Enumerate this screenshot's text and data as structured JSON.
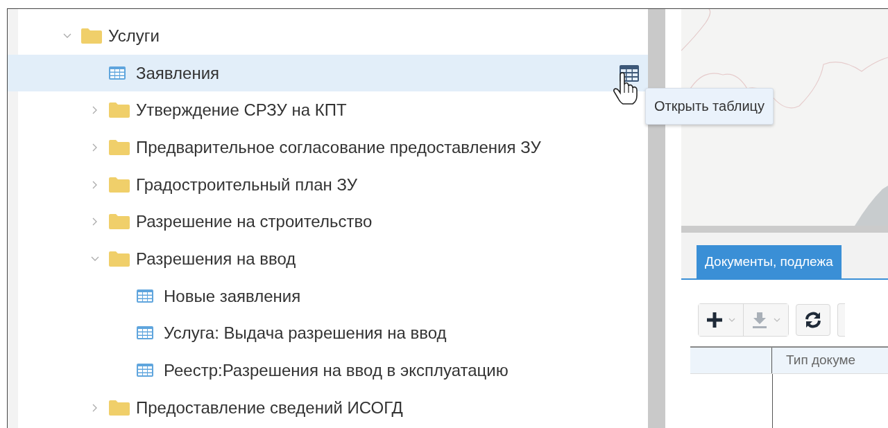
{
  "tree": [
    {
      "label": "Услуги",
      "kind": "folder",
      "expanded": true,
      "selected": false,
      "children": [
        {
          "label": "Заявления",
          "kind": "table",
          "selected": true,
          "hover_action": true
        },
        {
          "label": "Утверждение СРЗУ на КПТ",
          "kind": "folder",
          "expanded": false,
          "selected": false
        },
        {
          "label": "Предварительное согласование предоставления ЗУ",
          "kind": "folder",
          "expanded": false,
          "selected": false
        },
        {
          "label": "Градостроительный план ЗУ",
          "kind": "folder",
          "expanded": false,
          "selected": false
        },
        {
          "label": "Разрешение на строительство",
          "kind": "folder",
          "expanded": false,
          "selected": false
        },
        {
          "label": "Разрешения на ввод",
          "kind": "folder",
          "expanded": true,
          "selected": false,
          "children": [
            {
              "label": "Новые заявления",
              "kind": "table",
              "selected": false
            },
            {
              "label": "Услуга: Выдача разрешения на ввод",
              "kind": "table",
              "selected": false
            },
            {
              "label": "Реестр:Разрешения на ввод в эксплуатацию",
              "kind": "table",
              "selected": false
            }
          ]
        },
        {
          "label": "Предоставление сведений ИСОГД",
          "kind": "folder",
          "expanded": false,
          "selected": false
        }
      ]
    }
  ],
  "tooltip": "Открыть таблицу",
  "tabs": [
    {
      "label": "Документы, подлежа",
      "selected": true
    }
  ],
  "toolbar": [
    {
      "kind": "add",
      "disabled": false
    },
    {
      "kind": "download",
      "disabled": true
    },
    {
      "kind": "refresh"
    }
  ],
  "table": {
    "columns": [
      {
        "label": "Тип докуме"
      }
    ]
  }
}
